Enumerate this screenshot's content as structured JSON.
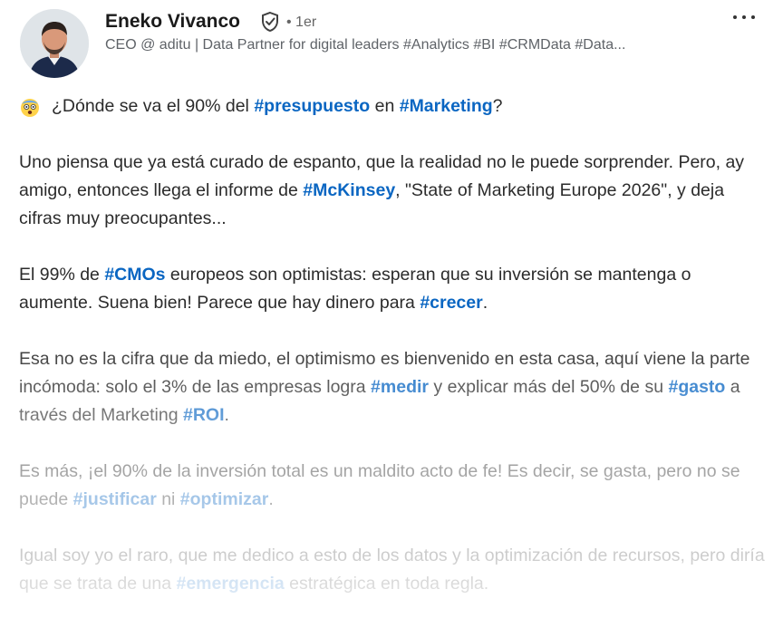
{
  "author": {
    "name": "Eneko Vivanco",
    "degree": "• 1er",
    "headline": "CEO @ aditu | Data Partner for digital leaders #Analytics #BI #CRMData #Data..."
  },
  "icons": {
    "verified": "verified-shield-icon",
    "more": "more-options-icon",
    "emoji": "shocked-face-emoji"
  },
  "post": {
    "p1": {
      "t1": "¿Dónde se va el 90% del ",
      "h1": "#presupuesto",
      "t2": " en ",
      "h2": "#Marketing",
      "t3": "?"
    },
    "p2": {
      "t1": "Uno piensa que ya está curado de espanto, que la realidad no le puede sorprender. Pero, ay amigo, entonces llega el informe de ",
      "h1": "#McKinsey",
      "t2": ", \"State of Marketing Europe 2026\", y deja cifras muy preocupantes..."
    },
    "p3": {
      "t1": "El 99% de ",
      "h1": "#CMOs",
      "t2": " europeos son optimistas: esperan que su inversión se mantenga o aumente. Suena bien! Parece que hay dinero para ",
      "h2": "#crecer",
      "t3": "."
    },
    "p4": {
      "t1": "Esa no es la cifra que da miedo, el optimismo es bienvenido en esta casa, aquí viene la parte incómoda: solo el 3% de las empresas logra ",
      "h1": "#medir",
      "t2": " y explicar más del 50% de su ",
      "h2": "#gasto",
      "t3": " a través del Marketing ",
      "h3": "#ROI",
      "t4": "."
    },
    "p5": {
      "t1": "Es más, ¡el 90% de la inversión total es un maldito acto de fe! Es decir, se gasta, pero no se puede ",
      "h1": "#justificar",
      "t2": " ni ",
      "h2": "#optimizar",
      "t3": "."
    },
    "p6": {
      "t1": "Igual soy yo el raro, que me dedico a esto de los datos y la optimización de recursos, pero diría que se trata de una ",
      "h1": "#emergencia",
      "t2": " estratégica en toda regla."
    }
  },
  "colors": {
    "hashtag": "#0a66c2",
    "text": "#2b2b2b",
    "muted": "#5f6368"
  }
}
